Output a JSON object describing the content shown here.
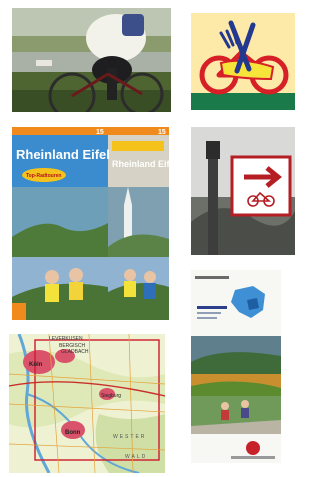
{
  "thumbnails": [
    {
      "id": "cyclist-photo",
      "kind": "photo"
    },
    {
      "id": "bike-cafe-logo",
      "kind": "logo"
    },
    {
      "id": "rheinland-eifel-cover",
      "kind": "book-cover",
      "cover_number": "15",
      "cover_title": "Rheinland Eifel",
      "badge_text": "Top-Radtouren",
      "back_title": "Rheinland Eifel",
      "back_number": "15"
    },
    {
      "id": "cycle-route-sign",
      "kind": "photo"
    },
    {
      "id": "flyer-cover",
      "kind": "brochure"
    },
    {
      "id": "region-map",
      "kind": "map",
      "labels": [
        "LEVERKUSEN",
        "BERGISCH",
        "GLADBACH",
        "Köln",
        "Bonn",
        "Siegburg",
        "WESTER",
        "WALD"
      ]
    }
  ]
}
